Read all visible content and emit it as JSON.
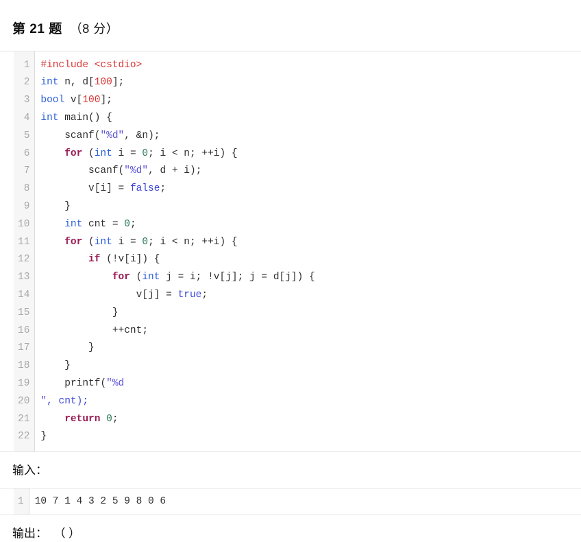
{
  "question": {
    "title": "第 21 题",
    "score": "（8 分）"
  },
  "code": {
    "language": "cpp",
    "line_numbers": [
      "1",
      "2",
      "3",
      "4",
      "5",
      "6",
      "7",
      "8",
      "9",
      "10",
      "11",
      "12",
      "13",
      "14",
      "15",
      "16",
      "17",
      "18",
      "19",
      "20",
      "21",
      "22"
    ],
    "lines": [
      "#include <cstdio>",
      "int n, d[100];",
      "bool v[100];",
      "int main() {",
      "    scanf(\"%d\", &n);",
      "    for (int i = 0; i < n; ++i) {",
      "        scanf(\"%d\", d + i);",
      "        v[i] = false;",
      "    }",
      "    int cnt = 0;",
      "    for (int i = 0; i < n; ++i) {",
      "        if (!v[i]) {",
      "            for (int j = i; !v[j]; j = d[j]) {",
      "                v[j] = true;",
      "            }",
      "            ++cnt;",
      "        }",
      "    }",
      "    printf(\"%d",
      "\", cnt);",
      "    return 0;",
      "}"
    ]
  },
  "input_section": {
    "label": "输入：",
    "line_numbers": [
      "1"
    ],
    "lines": [
      "10 7 1 4 3 2 5 9 8 0 6"
    ]
  },
  "output_section": {
    "label": "输出：  （ ）"
  },
  "colors": {
    "preprocessor": "#d83434",
    "keyword": "#9b1b55",
    "type": "#2b5fd9",
    "literal": "#3b46d6",
    "string": "#5b52d6",
    "number_red": "#d83434",
    "number_green": "#2a7b54",
    "gutter_bg": "#f6f6f6",
    "gutter_text": "#a8a8a8",
    "border": "#e4e4e4"
  }
}
